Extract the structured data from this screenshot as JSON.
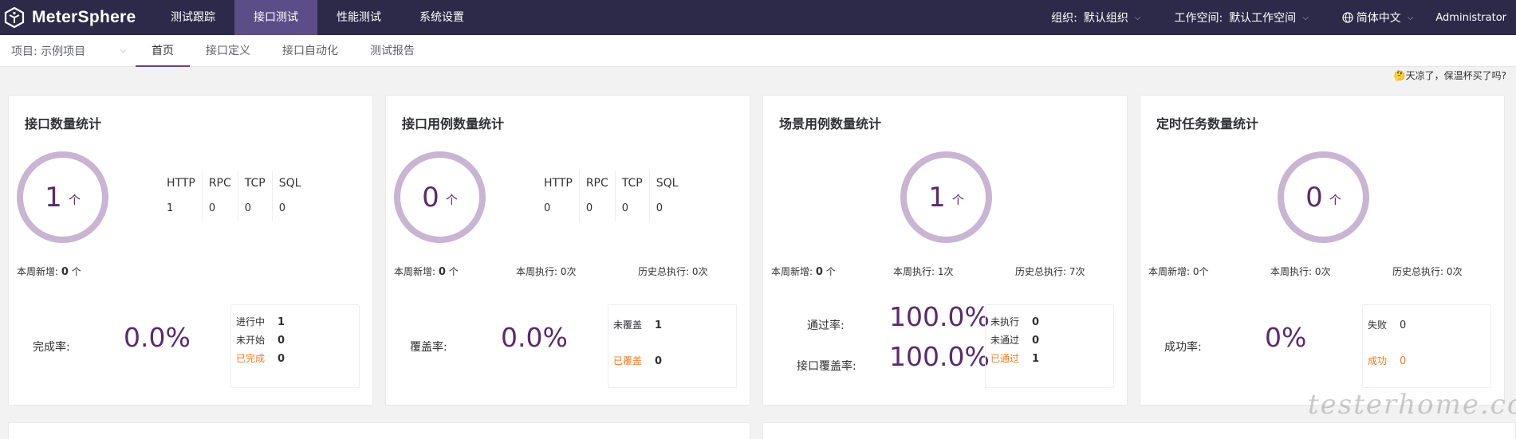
{
  "app": {
    "logo_text": "MeterSphere",
    "menu": [
      "测试跟踪",
      "接口测试",
      "性能测试",
      "系统设置"
    ],
    "active_menu": "接口测试",
    "org_label": "组织:",
    "org_value": "默认组织",
    "workspace_label": "工作空间:",
    "workspace_value": "默认工作空间",
    "language": "简体中文",
    "user": "Administrator",
    "accent_color": "#783887",
    "nav_bg": "#2c2a48"
  },
  "subnav": {
    "project": "项目: 示例项目",
    "tabs": [
      "首页",
      "接口定义",
      "接口自动化",
      "测试报告"
    ],
    "active_tab": "首页"
  },
  "notice": "🤔天凉了，保温杯买了吗?",
  "cards": {
    "api": {
      "title": "接口数量统计",
      "count": "1",
      "unit": "个",
      "protocols": {
        "headers": [
          "HTTP",
          "RPC",
          "TCP",
          "SQL"
        ],
        "values": [
          "1",
          "0",
          "0",
          "0"
        ]
      },
      "week_new_label": "本周新增:",
      "week_new_value": "0",
      "week_new_unit": "个",
      "rate_label": "完成率:",
      "rate_value": "0.0%",
      "legend": [
        {
          "label": "进行中",
          "value": "1"
        },
        {
          "label": "未开始",
          "value": "0"
        },
        {
          "label": "已完成",
          "value": "0"
        }
      ]
    },
    "case": {
      "title": "接口用例数量统计",
      "count": "0",
      "unit": "个",
      "protocols": {
        "headers": [
          "HTTP",
          "RPC",
          "TCP",
          "SQL"
        ],
        "values": [
          "0",
          "0",
          "0",
          "0"
        ]
      },
      "week_new_label": "本周新增:",
      "week_new_value": "0",
      "week_new_unit": "个",
      "week_exec": "本周执行: 0次",
      "history_exec": "历史总执行: 0次",
      "rate_label": "覆盖率:",
      "rate_value": "0.0%",
      "legend": [
        {
          "label": "未覆盖",
          "value": "1"
        },
        {
          "label": "已覆盖",
          "value": "0"
        }
      ]
    },
    "scenario": {
      "title": "场景用例数量统计",
      "count": "1",
      "unit": "个",
      "week_new_label": "本周新增:",
      "week_new_value": "0",
      "week_new_unit": "个",
      "week_exec": "本周执行: 1次",
      "history_exec": "历史总执行: 7次",
      "pass_label": "通过率:",
      "pass_value": "100.0%",
      "coverage_label": "接口覆盖率:",
      "coverage_value": "100.0%",
      "legend": [
        {
          "label": "未执行",
          "value": "0"
        },
        {
          "label": "未通过",
          "value": "0"
        },
        {
          "label": "已通过",
          "value": "1"
        }
      ]
    },
    "schedule": {
      "title": "定时任务数量统计",
      "count": "0",
      "unit": "个",
      "week_new": "本周新增: 0个",
      "week_exec": "本周执行: 0次",
      "history_exec": "历史总执行: 0次",
      "rate_label": "成功率:",
      "rate_value": "0%",
      "legend": [
        {
          "label": "失败",
          "value": "0"
        },
        {
          "label": "成功",
          "value": "0"
        }
      ]
    }
  },
  "watermark": "testerhome.com"
}
